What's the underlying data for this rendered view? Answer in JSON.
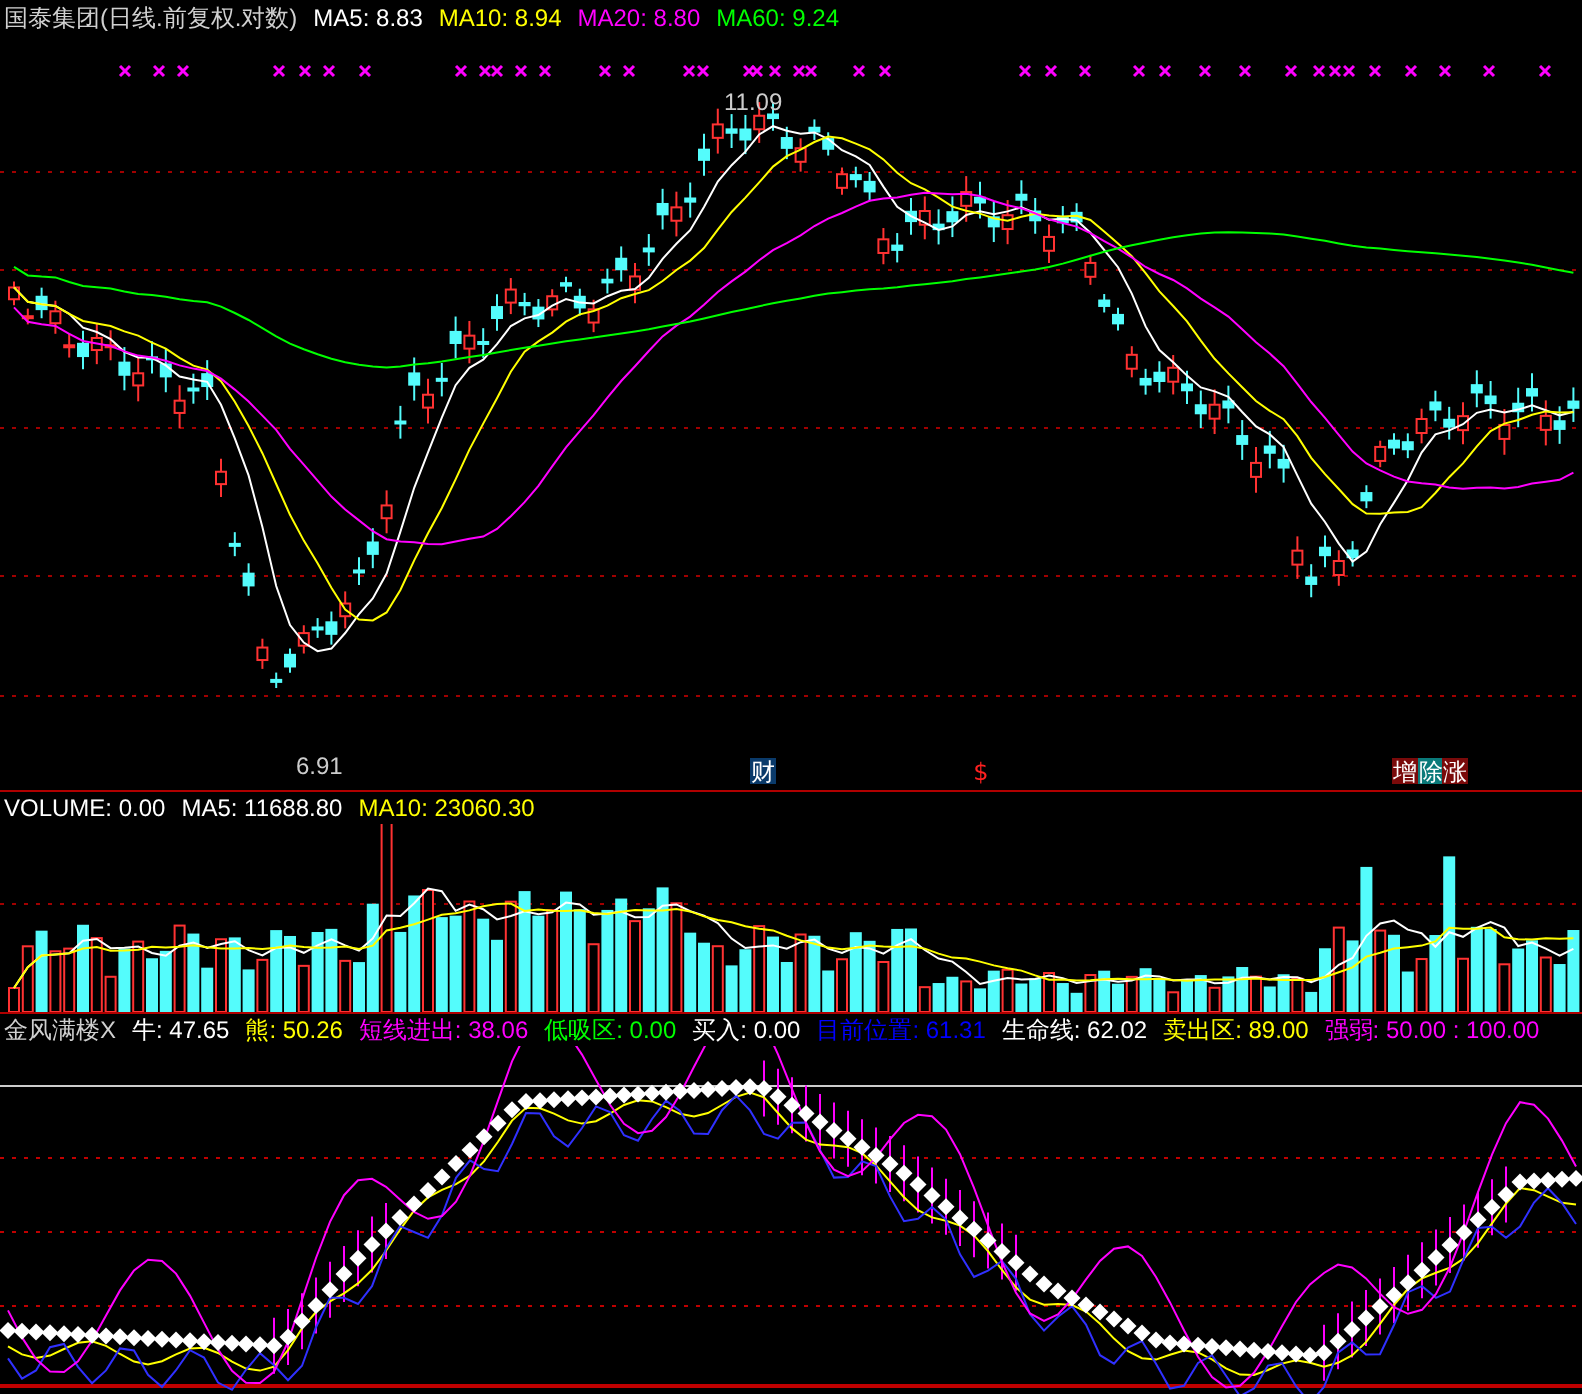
{
  "main_panel": {
    "title": "国泰集团(日线.前复权.对数)",
    "indicators": [
      {
        "label": "MA5: 8.83",
        "color": "#ffffff"
      },
      {
        "label": "MA10: 8.94",
        "color": "#ffff00"
      },
      {
        "label": "MA20: 8.80",
        "color": "#ff00ff"
      },
      {
        "label": "MA60: 9.24",
        "color": "#00ff00"
      }
    ],
    "high_label": "11.09",
    "low_label": "6.91",
    "event_markers": [
      {
        "text": "财",
        "color": "#0a3a6a"
      },
      {
        "text": "$",
        "color": "#000000"
      },
      {
        "text": "增",
        "color": "#7a0a0a"
      },
      {
        "text": "除",
        "color": "#0a7a7a"
      },
      {
        "text": "涨",
        "color": "#7a0a0a"
      }
    ]
  },
  "volume_panel": {
    "indicators": [
      {
        "label": "VOLUME: 0.00",
        "color": "#ffffff"
      },
      {
        "label": "MA5: 11688.80",
        "color": "#ffffff"
      },
      {
        "label": "MA10: 23060.30",
        "color": "#ffff00"
      }
    ]
  },
  "indicator_panel": {
    "title": "金风满楼X",
    "indicators": [
      {
        "label": "牛: 47.65",
        "color": "#ffffff"
      },
      {
        "label": "熊: 50.26",
        "color": "#ffff00"
      },
      {
        "label": "短线进出: 38.06",
        "color": "#ff00ff"
      },
      {
        "label": "低吸区: 0.00",
        "color": "#00ff00"
      },
      {
        "label": "买入: 0.00",
        "color": "#ffffff"
      },
      {
        "label": "目前位置: 61.31",
        "color": "#0000ff"
      },
      {
        "label": "生命线: 62.02",
        "color": "#ffffff"
      },
      {
        "label": "卖出区: 89.00",
        "color": "#ffff00"
      },
      {
        "label": "强弱: 50.00 : 100.00",
        "color": "#ff00ff"
      }
    ]
  }
}
